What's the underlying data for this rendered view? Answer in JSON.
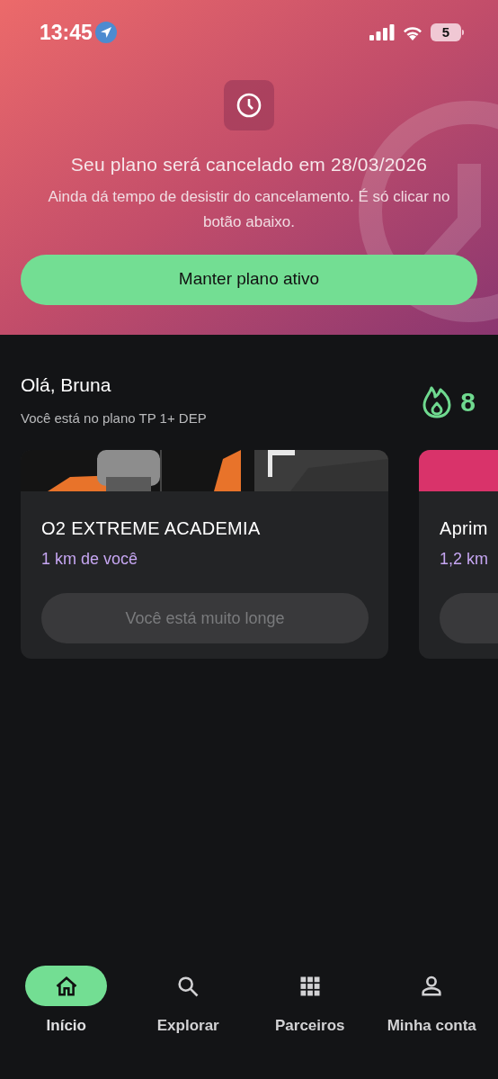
{
  "status_bar": {
    "time": "13:45",
    "battery": "5"
  },
  "banner": {
    "title": "Seu plano será cancelado em 28/03/2026",
    "message": "Ainda dá tempo de desistir do cancelamento. É só clicar no botão abaixo.",
    "button": "Manter plano ativo"
  },
  "greeting": {
    "title": "Olá, Bruna",
    "subtitle": "Você está no plano TP 1+ DEP",
    "streak": "8"
  },
  "gyms": [
    {
      "name": "O2 EXTREME ACADEMIA",
      "distance": "1 km de você",
      "button": "Você está muito longe",
      "disabled": true
    },
    {
      "kind": "color",
      "color": "#d9336a",
      "name": "Aprim",
      "distance": "1,2 km",
      "disabled": true
    }
  ],
  "nav": [
    {
      "kind": "home",
      "label": "Início",
      "selected": true
    },
    {
      "kind": "search",
      "label": "Explorar",
      "selected": false
    },
    {
      "kind": "grid",
      "label": "Parceiros",
      "selected": false
    },
    {
      "kind": "person",
      "label": "Minha conta",
      "selected": false
    }
  ]
}
